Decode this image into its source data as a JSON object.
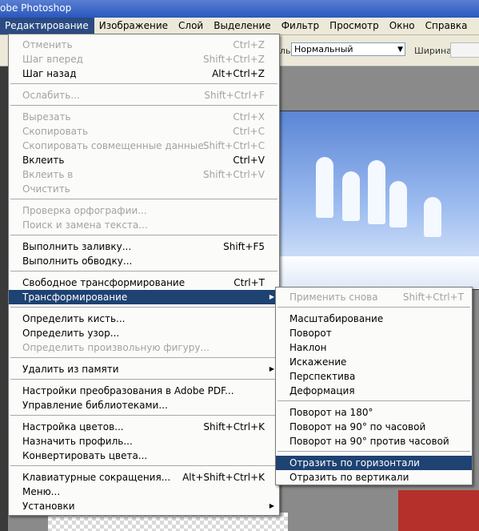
{
  "window": {
    "title": "obe Photoshop"
  },
  "menubar": {
    "items": [
      "Редактирование",
      "Изображение",
      "Слой",
      "Выделение",
      "Фильтр",
      "Просмотр",
      "Окно",
      "Справка"
    ],
    "active_index": 0
  },
  "options_bar": {
    "mode_label_fragment": "ль:",
    "mode_value": "Нормальный",
    "width_label": "Ширина:"
  },
  "edit_menu": {
    "undo": {
      "label": "Отменить",
      "shortcut": "Ctrl+Z"
    },
    "step_forward": {
      "label": "Шаг вперед",
      "shortcut": "Shift+Ctrl+Z"
    },
    "step_back": {
      "label": "Шаг назад",
      "shortcut": "Alt+Ctrl+Z"
    },
    "fade": {
      "label": "Ослабить...",
      "shortcut": "Shift+Ctrl+F"
    },
    "cut": {
      "label": "Вырезать",
      "shortcut": "Ctrl+X"
    },
    "copy": {
      "label": "Скопировать",
      "shortcut": "Ctrl+C"
    },
    "copy_merged": {
      "label": "Скопировать совмещенные данные",
      "shortcut": "Shift+Ctrl+C"
    },
    "paste": {
      "label": "Вклеить",
      "shortcut": "Ctrl+V"
    },
    "paste_into": {
      "label": "Вклеить в",
      "shortcut": "Shift+Ctrl+V"
    },
    "clear": {
      "label": "Очистить"
    },
    "spelling": {
      "label": "Проверка орфографии..."
    },
    "find_replace": {
      "label": "Поиск и замена текста..."
    },
    "fill": {
      "label": "Выполнить заливку...",
      "shortcut": "Shift+F5"
    },
    "stroke": {
      "label": "Выполнить обводку..."
    },
    "free_transform": {
      "label": "Свободное трансформирование",
      "shortcut": "Ctrl+T"
    },
    "transform": {
      "label": "Трансформирование"
    },
    "define_brush": {
      "label": "Определить кисть..."
    },
    "define_pattern": {
      "label": "Определить узор..."
    },
    "define_shape": {
      "label": "Определить произвольную фигуру..."
    },
    "purge": {
      "label": "Удалить из памяти"
    },
    "pdf_presets": {
      "label": "Настройки преобразования в Adobe PDF..."
    },
    "preset_manager": {
      "label": "Управление библиотеками..."
    },
    "color_settings": {
      "label": "Настройка цветов...",
      "shortcut": "Shift+Ctrl+K"
    },
    "assign_profile": {
      "label": "Назначить профиль..."
    },
    "convert_profile": {
      "label": "Конвертировать цвета..."
    },
    "keyboard_shortcuts": {
      "label": "Клавиатурные сокращения...",
      "shortcut": "Alt+Shift+Ctrl+K"
    },
    "menus": {
      "label": "Меню..."
    },
    "preferences": {
      "label": "Установки"
    }
  },
  "transform_menu": {
    "again": {
      "label": "Применить снова",
      "shortcut": "Shift+Ctrl+T"
    },
    "scale": "Масштабирование",
    "rotate": "Поворот",
    "skew": "Наклон",
    "distort": "Искажение",
    "perspective": "Перспектива",
    "warp": "Деформация",
    "rotate_180": "Поворот на 180°",
    "rotate_90_cw": "Поворот на 90° по часовой",
    "rotate_90_ccw": "Поворот на 90° против часовой",
    "flip_horizontal": "Отразить по горизонтали",
    "flip_vertical": "Отразить по вертикали"
  }
}
